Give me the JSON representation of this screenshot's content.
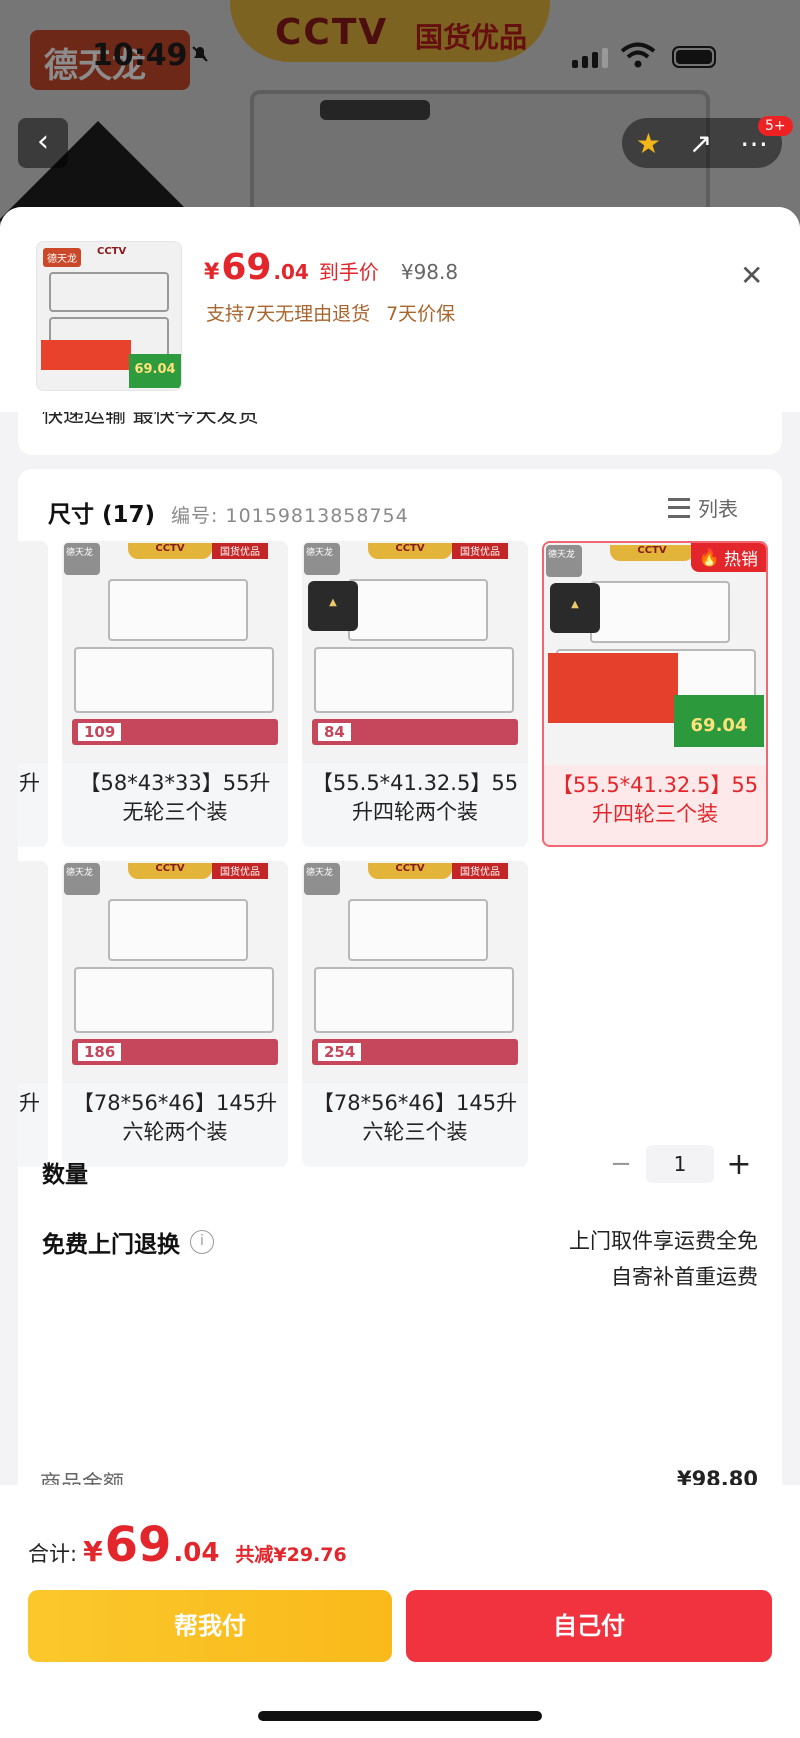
{
  "status_bar": {
    "time": "10:49"
  },
  "background": {
    "brand": "德天龙",
    "cctv": "CCTV",
    "guohuo": "国货优品",
    "nav_badge": "5+"
  },
  "header": {
    "price_symbol": "¥",
    "price_int": "69",
    "price_dec": ".04",
    "price_tag": "到手价",
    "original_price": "¥98.8",
    "promises": [
      "支持7天无理由退货",
      "7天价保"
    ],
    "thumb_price": "69.04"
  },
  "shipping": {
    "text": "快递运输 最快今天发货"
  },
  "spec": {
    "title": "尺寸 (17)",
    "code_label": "编号: 10159813858754",
    "list_label": "列表",
    "hot_label": "热销",
    "options": [
      {
        "line1": "【58*43*33】55升",
        "line2": "无轮三个装",
        "price": "109",
        "selected": false
      },
      {
        "line1": "【55.5*41.32.5】55",
        "line2": "升四轮两个装",
        "price": "84",
        "selected": false
      },
      {
        "line1": "【55.5*41.32.5】55",
        "line2": "升四轮三个装",
        "price": "69.04",
        "selected": true
      },
      {
        "line1": "【78*56*46】145升",
        "line2": "六轮两个装",
        "price": "186",
        "selected": false
      },
      {
        "line1": "【78*56*46】145升",
        "line2": "六轮三个装",
        "price": "254",
        "selected": false
      }
    ],
    "edge_label": "升"
  },
  "quantity": {
    "label": "数量",
    "value": "1",
    "minus": "−",
    "plus": "+"
  },
  "returns": {
    "label": "免费上门退换",
    "line1": "上门取件享运费全免",
    "line2": "自寄补首重运费"
  },
  "amount": {
    "label": "商品金额",
    "value": "¥98.80"
  },
  "footer": {
    "total_label": "合计:",
    "total_symbol": "¥",
    "total_int": "69",
    "total_dec": ".04",
    "saved": "共减¥29.76",
    "help_pay": "帮我付",
    "self_pay": "自己付"
  },
  "colors": {
    "accent": "#e3262b",
    "help_btn": "#fbc82c",
    "self_btn": "#f0333f"
  }
}
